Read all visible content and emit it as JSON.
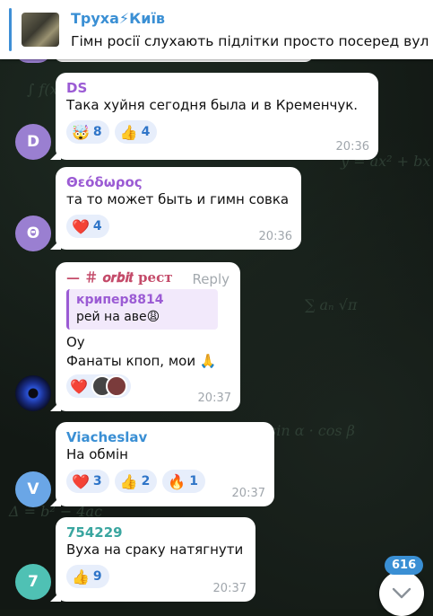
{
  "pinned": {
    "title": "Труха⚡Київ",
    "text": "Гімн росії слухають підлітки просто посеред вулиц..."
  },
  "messages": [
    {
      "author": "DS",
      "author_color": "#9b5bd4",
      "avatar_letter": "D",
      "avatar_color": "#9a7fd1",
      "lines": [
        "Така хуйня сегодня  была и  в Кременчук."
      ],
      "reactions": [
        {
          "emoji": "🤯",
          "count": "8"
        },
        {
          "emoji": "👍",
          "count": "4"
        }
      ],
      "time": "20:36"
    },
    {
      "author": "Θεόδωρος",
      "author_color": "#9b5bd4",
      "avatar_letter": "Θ",
      "avatar_color": "#9a7fd1",
      "lines": [
        "та то может быть и гимн совка"
      ],
      "reactions": [
        {
          "emoji": "❤️",
          "count": "4"
        }
      ],
      "time": "20:36"
    },
    {
      "author": "— ＃ 𝒐𝒓𝒃𝒊𝒕 рест",
      "author_color": "#c44b6a",
      "reply_label": "Reply",
      "quote": {
        "name": "крипер8814",
        "text": "рей на аве😩"
      },
      "lines": [
        "Оу",
        "Фанаты кпоп, мои 🙏"
      ],
      "reactions": [
        {
          "emoji": "❤️",
          "count": ""
        }
      ],
      "time": "20:37"
    },
    {
      "author": "Viacheslav",
      "author_color": "#3a8fd4",
      "avatar_letter": "V",
      "avatar_color": "#6aa6e6",
      "lines": [
        "На обмін"
      ],
      "reactions": [
        {
          "emoji": "❤️",
          "count": "3"
        },
        {
          "emoji": "👍",
          "count": "2"
        },
        {
          "emoji": "🔥",
          "count": "1"
        }
      ],
      "time": "20:37"
    },
    {
      "author": "754229",
      "author_color": "#3aa6a0",
      "avatar_letter": "7",
      "avatar_color": "#4fc1b4",
      "lines": [
        "Вуха на сраку натягнути"
      ],
      "reactions": [
        {
          "emoji": "👍",
          "count": "9"
        }
      ],
      "time": "20:37"
    }
  ],
  "unread_count": "616"
}
